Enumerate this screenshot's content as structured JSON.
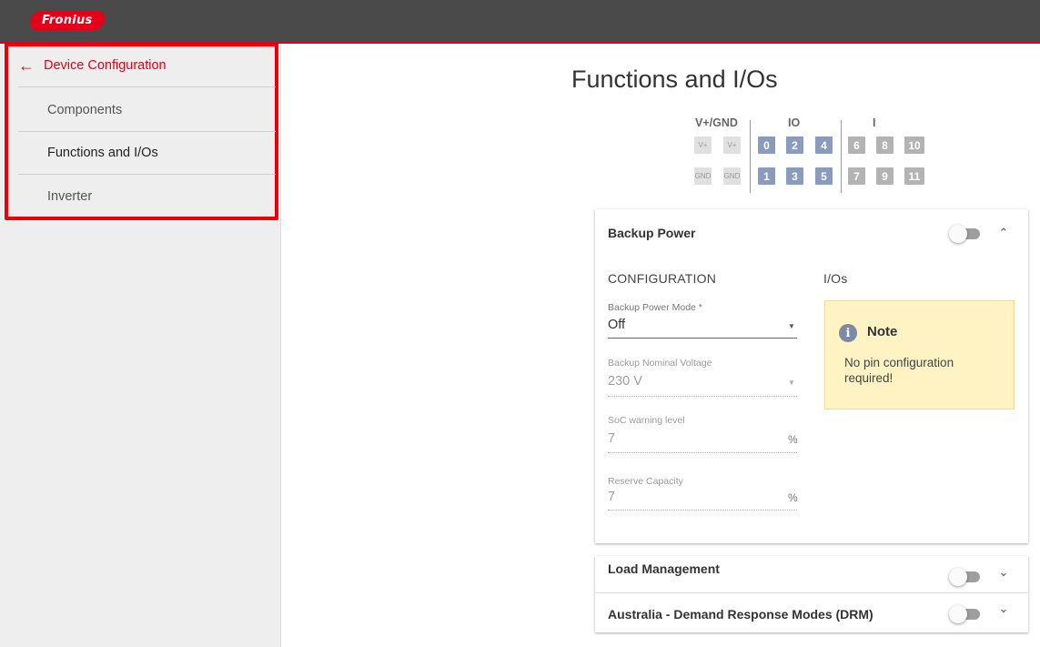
{
  "header": {
    "logo_text": "Fronius",
    "brand_color": "#e2001a"
  },
  "sidebar": {
    "back_label": "Device Configuration",
    "items": [
      {
        "label": "Components"
      },
      {
        "label": "Functions and I/Os"
      },
      {
        "label": "Inverter"
      }
    ]
  },
  "page": {
    "title": "Functions and I/Os"
  },
  "pins": {
    "groups": [
      "V+/GND",
      "IO",
      "I"
    ],
    "vplus": [
      "V+",
      "V+"
    ],
    "gnd": [
      "GND",
      "GND"
    ],
    "io_top": [
      "0",
      "2",
      "4"
    ],
    "io_bottom": [
      "1",
      "3",
      "5"
    ],
    "i_top": [
      "6",
      "8",
      "10"
    ],
    "i_bottom": [
      "7",
      "9",
      "11"
    ]
  },
  "backup": {
    "title": "Backup Power",
    "config_label": "CONFIGURATION",
    "ios_label": "I/Os",
    "mode": {
      "label": "Backup Power Mode *",
      "value": "Off"
    },
    "voltage": {
      "label": "Backup Nominal Voltage",
      "value": "230 V"
    },
    "soc": {
      "label": "SoC warning level",
      "value": "7",
      "unit": "%"
    },
    "reserve": {
      "label": "Reserve Capacity",
      "value": "7",
      "unit": "%"
    },
    "note": {
      "title": "Note",
      "text": "No pin configuration required!"
    }
  },
  "load": {
    "title": "Load Management"
  },
  "drm": {
    "title": "Australia - Demand Response Modes (DRM)"
  }
}
